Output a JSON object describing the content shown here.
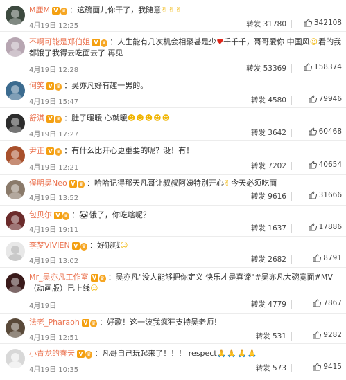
{
  "colors": {
    "username": "#eb7350",
    "vip_badge": "#f4a011",
    "date": "#808080",
    "text": "#333333"
  },
  "repost_label": "转发",
  "comments": [
    {
      "user": "M鹿M",
      "text": "这碗面儿你干了，我随意",
      "emoji": "✌✌✌",
      "date": "4月19日 12:25",
      "reposts": "31780",
      "likes": "342108",
      "avatar_color": "#3d4a3f"
    },
    {
      "user": "不啊可能是郑伯姐",
      "text": "人生能有几次机会相聚甚是少",
      "heart": "♥",
      "text2": "千千千，哥哥爱你 中国风",
      "emoji": "☺",
      "text3": "看的我都饿了我得去吃面去了 再见",
      "date": "4月19日 12:28",
      "reposts": "53369",
      "likes": "158374",
      "avatar_color": "#b7a6b2"
    },
    {
      "user": "何笑",
      "text": "吴亦凡好有趣一男的。",
      "date": "4月19日 15:47",
      "reposts": "4580",
      "likes": "79946",
      "avatar_color": "#3b6b8f"
    },
    {
      "user": "舒淇",
      "text": "肚子暖暖 心就暖",
      "emoji": "☻☻☻☻☻",
      "date": "4月19日 17:27",
      "reposts": "3642",
      "likes": "60468",
      "avatar_color": "#2c2c2c"
    },
    {
      "user": "尹正",
      "text": "有什么比开心更重要的呢？没！有！",
      "date": "4月19日 12:21",
      "reposts": "7202",
      "likes": "40654",
      "avatar_color": "#a8502c"
    },
    {
      "user": "俣明昊Neo",
      "text": "哈哈记得那天凡哥让叔叔阿姨特别开心",
      "emoji": "✌",
      "text2": "今天必须吃面",
      "date": "4月19日 13:52",
      "reposts": "9616",
      "likes": "31666",
      "avatar_color": "#8a7a6a"
    },
    {
      "user": "包贝尔",
      "text": "饿了，你吃啥呢？",
      "emoji": "🐼",
      "date": "4月19日 19:11",
      "reposts": "1637",
      "likes": "17886",
      "avatar_color": "#6b2b2b"
    },
    {
      "user": "李梦VIVIEN",
      "text": "好饿哦",
      "emoji": "☺",
      "date": "4月19日 13:02",
      "reposts": "2682",
      "likes": "8791",
      "avatar_color": "#e8e8e8"
    },
    {
      "user": "Mr_吴亦凡工作室",
      "text": "吴亦凡\"没人能够把你定义 快乐才是真谛\"#吴亦凡大碗宽面#MV（动画版）已上线",
      "emoji": "☺",
      "date": "4月19日",
      "reposts": "4779",
      "likes": "7867",
      "avatar_color": "#3a1a1a"
    },
    {
      "user": "法老_Pharaoh",
      "text": "好歌！这一波我疯狂支持吴老师！",
      "date": "4月19日 12:51",
      "reposts": "531",
      "likes": "9282",
      "avatar_color": "#5a4a3a"
    },
    {
      "user": "小青龙的春天",
      "text": "凡哥自己玩起来了！！！ respect",
      "emoji": "🙏🙏🙏🙏",
      "date": "4月19日 10:35",
      "reposts": "573",
      "likes": "9415",
      "avatar_color": "#d8d8d8"
    }
  ]
}
